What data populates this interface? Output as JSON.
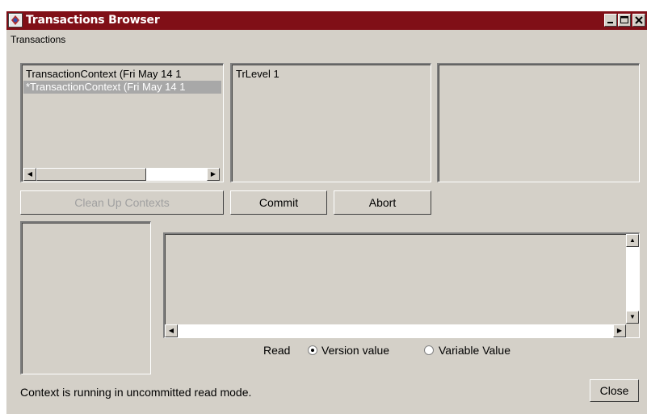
{
  "window": {
    "title": "Transactions Browser",
    "accent_color": "#800f17"
  },
  "menu": {
    "items": [
      "Transactions"
    ]
  },
  "contexts_list": {
    "items": [
      {
        "label": "TransactionContext (Fri May 14 1",
        "selected": false
      },
      {
        "label": "*TransactionContext (Fri May 14 1",
        "selected": true
      }
    ]
  },
  "levels_list": {
    "items": [
      "TrLevel 1"
    ]
  },
  "buttons": {
    "cleanup": "Clean Up Contexts",
    "commit": "Commit",
    "abort": "Abort",
    "close": "Close"
  },
  "read_mode": {
    "label": "Read",
    "options": [
      {
        "label": "Version value",
        "selected": true
      },
      {
        "label": "Variable Value",
        "selected": false
      }
    ]
  },
  "status": "Context is running in uncommitted read mode.",
  "icons": [
    "app-icon",
    "minimize-icon",
    "maximize-icon",
    "close-icon",
    "scroll-left-icon",
    "scroll-right-icon",
    "scroll-up-icon",
    "scroll-down-icon"
  ]
}
